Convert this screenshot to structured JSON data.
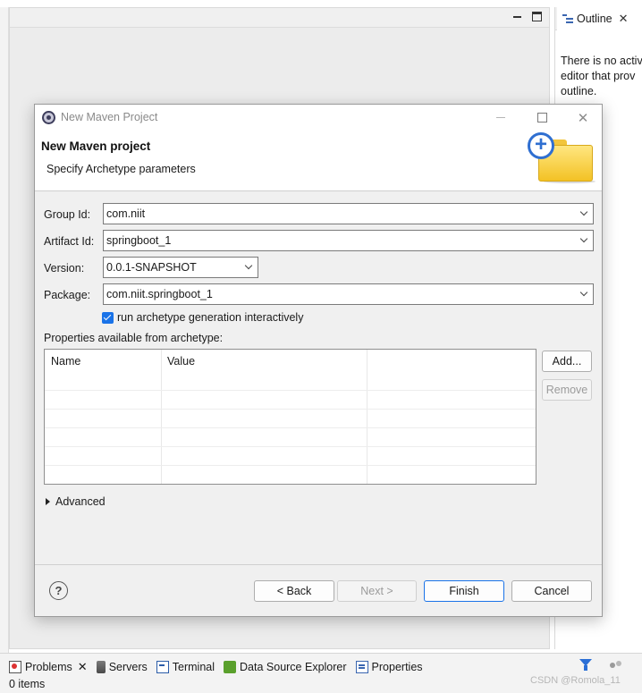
{
  "ide": {
    "outline": {
      "tab_label": "Outline",
      "message_lines": [
        "There is no activ",
        "editor that prov",
        "outline."
      ]
    },
    "bottom_tabs": [
      {
        "label": "Problems",
        "icon": "problems-icon"
      },
      {
        "label": "Servers",
        "icon": "servers-icon"
      },
      {
        "label": "Terminal",
        "icon": "terminal-icon"
      },
      {
        "label": "Data Source Explorer",
        "icon": "data-source-explorer-icon"
      },
      {
        "label": "Properties",
        "icon": "properties-icon"
      }
    ],
    "status": "0 items",
    "watermark": "CSDN @Romola_11"
  },
  "dialog": {
    "title": "New Maven Project",
    "header_title": "New Maven project",
    "header_subtitle": "Specify Archetype parameters",
    "fields": {
      "group_id": {
        "label": "Group Id:",
        "value": "com.niit"
      },
      "artifact_id": {
        "label": "Artifact Id:",
        "value": "springboot_1"
      },
      "version": {
        "label": "Version:",
        "value": "0.0.1-SNAPSHOT"
      },
      "package": {
        "label": "Package:",
        "value": "com.niit.springboot_1"
      }
    },
    "checkbox": {
      "label": "run archetype generation interactively",
      "checked": true
    },
    "properties_label": "Properties available from archetype:",
    "table": {
      "columns": [
        "Name",
        "Value"
      ],
      "rows": []
    },
    "side_buttons": {
      "add": "Add...",
      "remove": "Remove"
    },
    "advanced_label": "Advanced",
    "buttons": {
      "back": "< Back",
      "next": "Next >",
      "finish": "Finish",
      "cancel": "Cancel"
    },
    "accent_color": "#1a73e8"
  }
}
